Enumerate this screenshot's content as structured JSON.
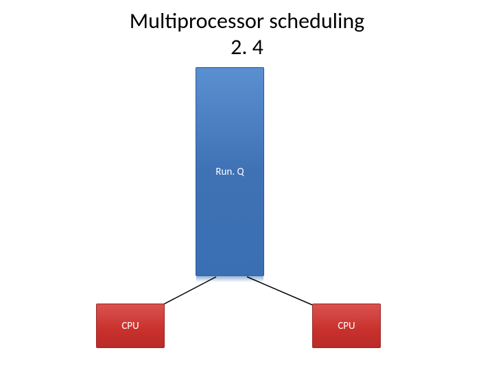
{
  "title": {
    "line1": "Multiprocessor scheduling",
    "line2": "2. 4"
  },
  "diagram": {
    "queue_label": "Run. Q",
    "cpu_left_label": "CPU",
    "cpu_right_label": "CPU"
  },
  "colors": {
    "queue_fill": "#3f72b5",
    "cpu_fill": "#c9302c",
    "arrow": "#000000"
  }
}
